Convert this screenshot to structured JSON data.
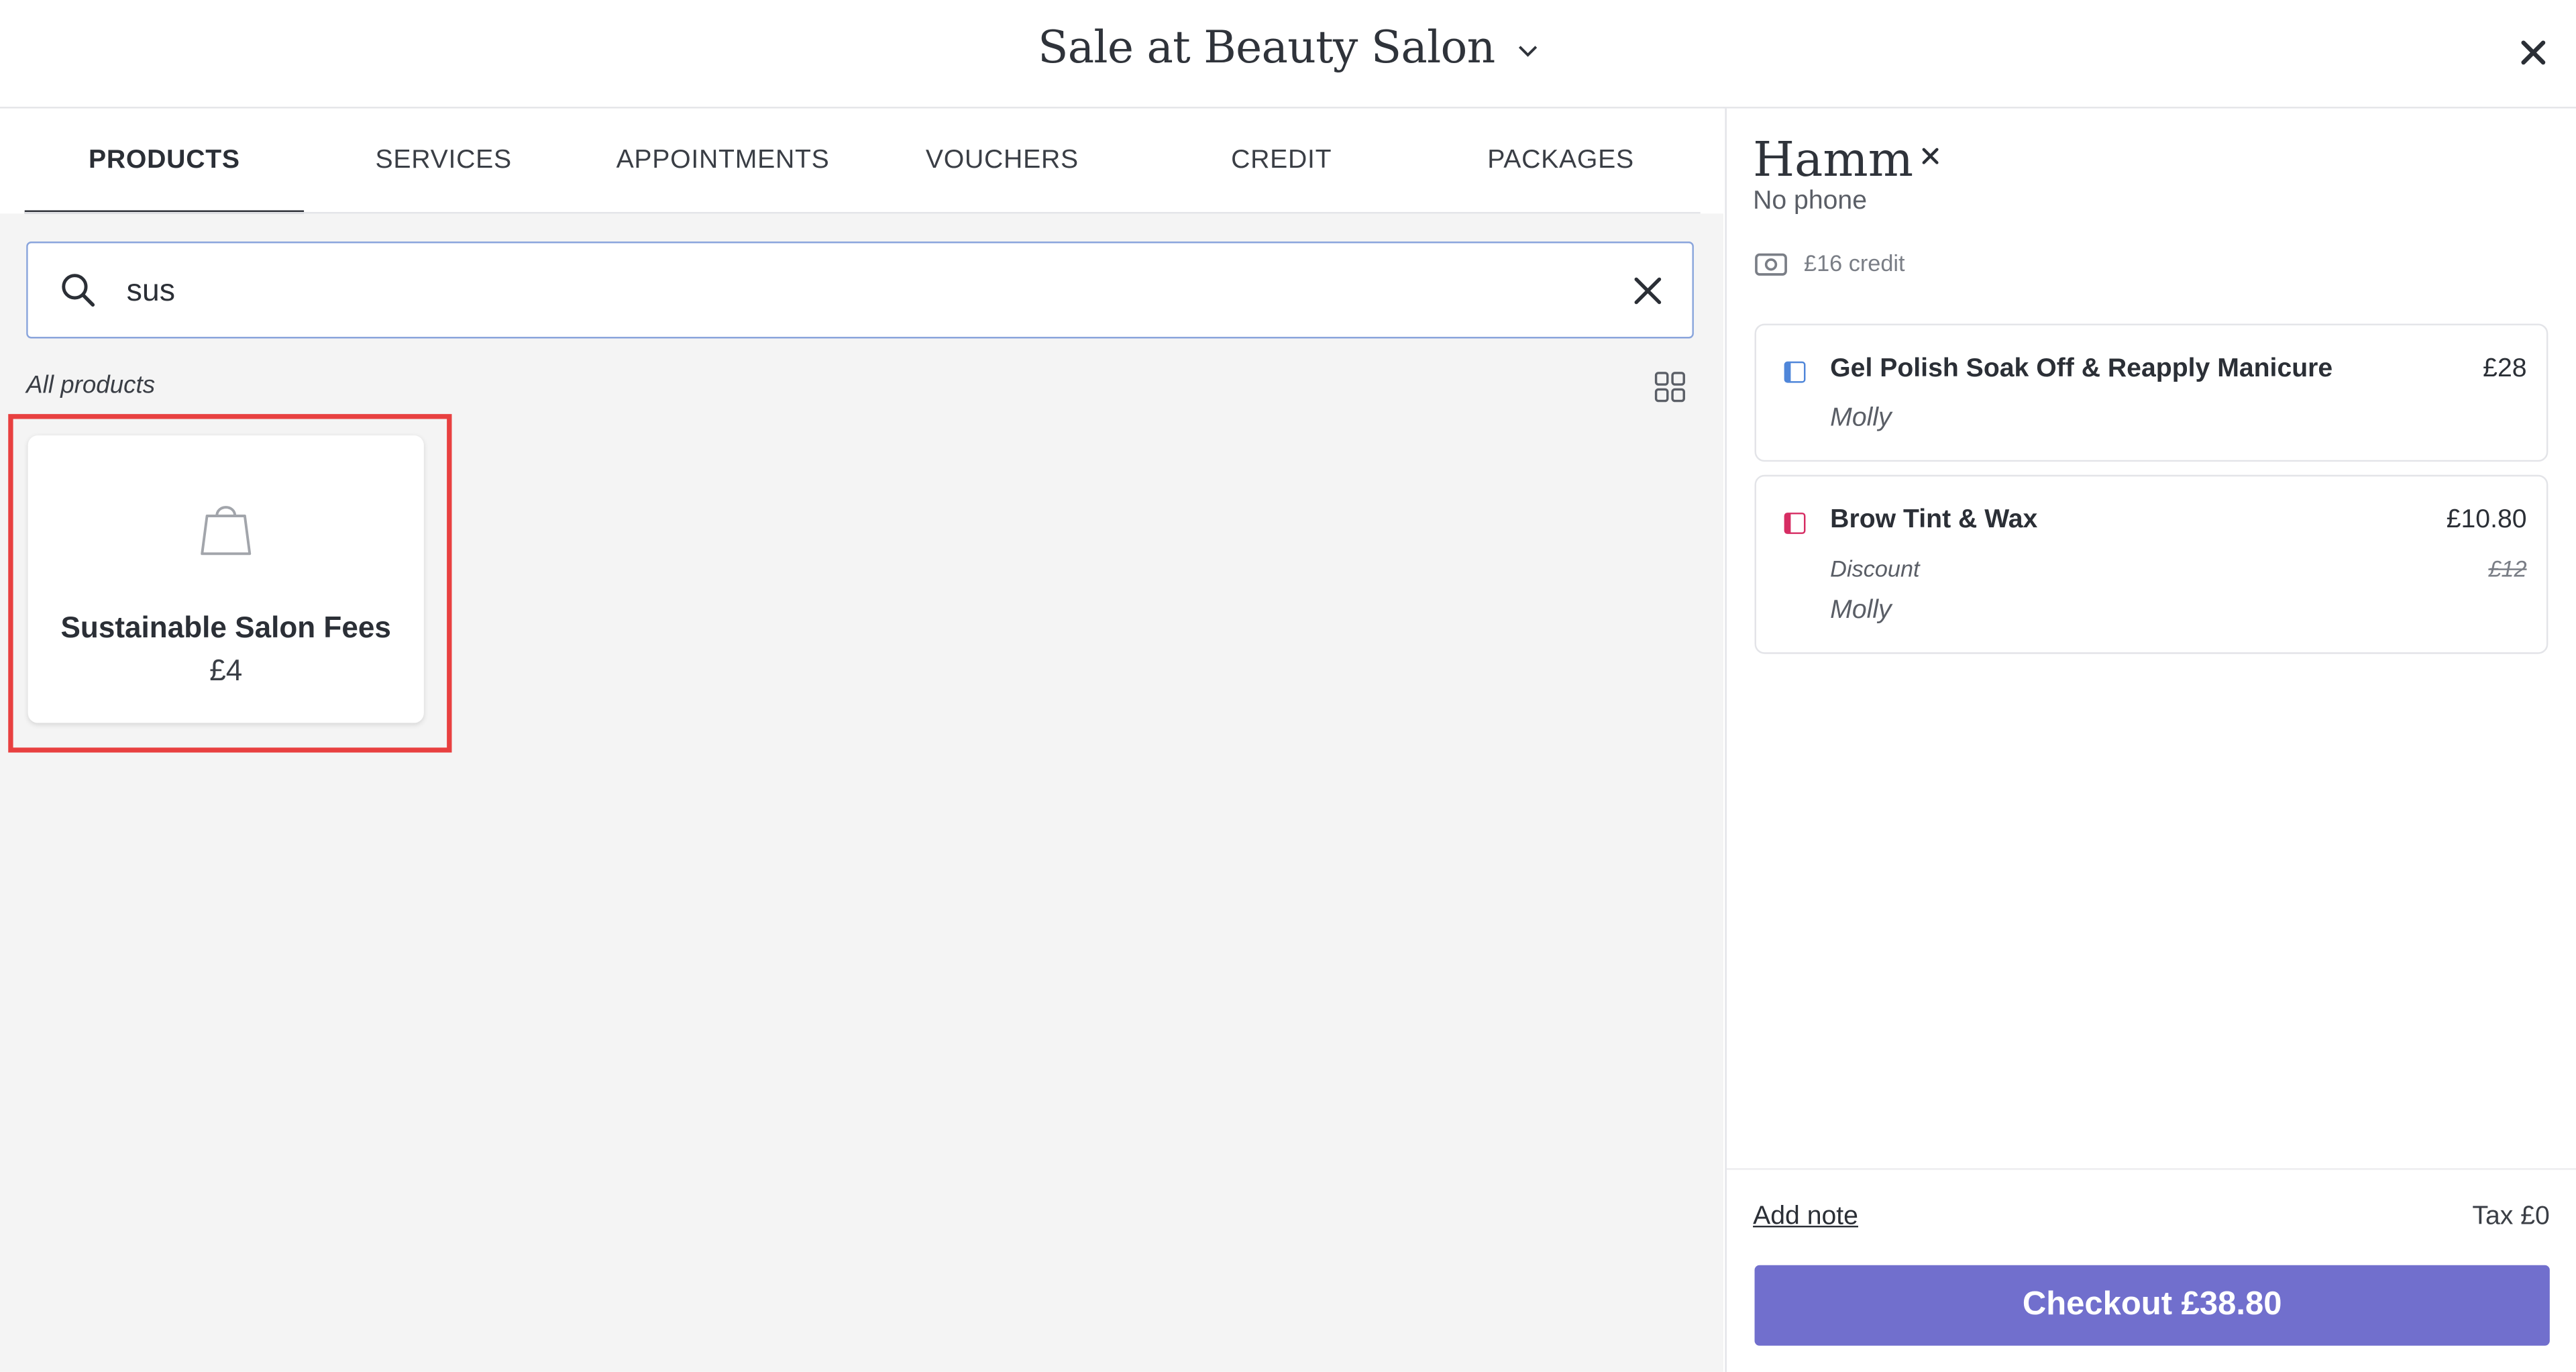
{
  "header": {
    "title": "Sale at Beauty Salon",
    "dropdown_icon": "chevron-down-icon",
    "close_icon": "close-icon"
  },
  "tabs": [
    {
      "label": "PRODUCTS",
      "active": true
    },
    {
      "label": "SERVICES",
      "active": false
    },
    {
      "label": "APPOINTMENTS",
      "active": false
    },
    {
      "label": "VOUCHERS",
      "active": false
    },
    {
      "label": "CREDIT",
      "active": false
    },
    {
      "label": "PACKAGES",
      "active": false
    }
  ],
  "search": {
    "value": "sus",
    "icon": "search-icon",
    "clear_icon": "close-icon"
  },
  "products": {
    "section_label": "All products",
    "view_icon": "grid-view-icon",
    "items": [
      {
        "name": "Sustainable Salon Fees",
        "price": "£4",
        "icon": "shopping-bag-icon"
      }
    ]
  },
  "client": {
    "name": "Hamm",
    "phone": "No phone",
    "credit": "£16 credit",
    "credit_icon": "cash-icon"
  },
  "cart": {
    "items": [
      {
        "name": "Gel Polish Soak Off & Reapply Manicure",
        "price": "£28",
        "staff": "Molly",
        "color": "#4f86d9"
      },
      {
        "name": "Brow Tint & Wax",
        "price": "£10.80",
        "discount_label": "Discount",
        "original_price": "£12",
        "staff": "Molly",
        "color": "#d62d63"
      }
    ],
    "add_note": "Add note",
    "tax": "Tax £0",
    "checkout": "Checkout £38.80",
    "accent_color": "#716fcd"
  }
}
